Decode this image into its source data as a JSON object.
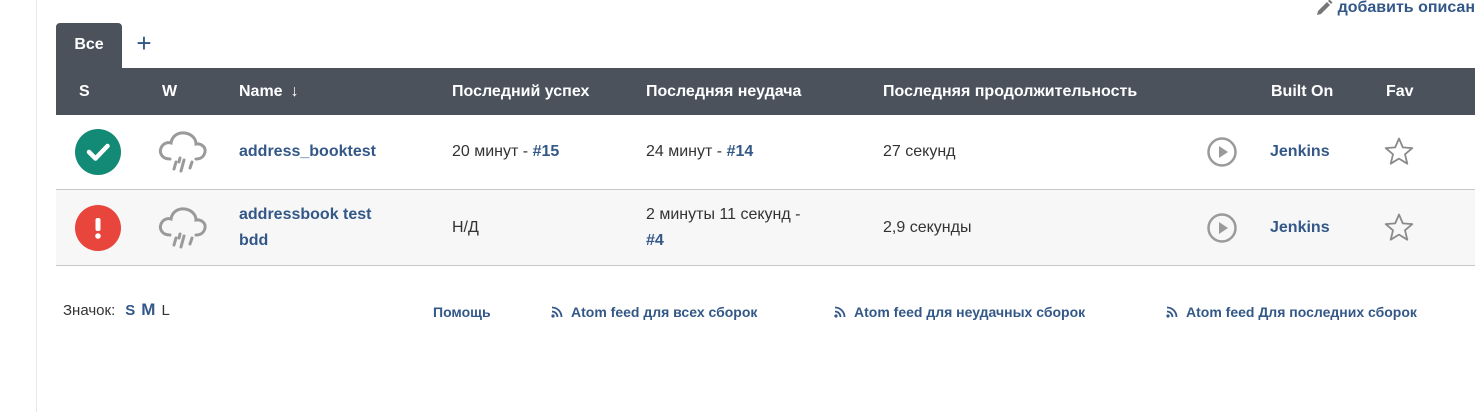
{
  "header": {
    "add_description": "добавить описан"
  },
  "tabs": {
    "active": "Все",
    "add": "+"
  },
  "table": {
    "columns": {
      "s": "S",
      "w": "W",
      "name": "Name",
      "name_sort": "↓",
      "last_success": "Последний успех",
      "last_failure": "Последняя неудача",
      "last_duration": "Последняя продолжительность",
      "built_on": "Built On",
      "fav": "Fav"
    },
    "rows": [
      {
        "status": "success",
        "weather": "rain-cloud-icon",
        "name": "address_booktest",
        "last_success_text": "20 минут - ",
        "last_success_build": "#15",
        "last_failure_text": "24 минут - ",
        "last_failure_build": "#14",
        "duration": "27 секунд",
        "built_on": "Jenkins"
      },
      {
        "status": "failure",
        "weather": "rain-cloud-icon",
        "name_line1": "addressbook test",
        "name_line2": "bdd",
        "last_success_text": "Н/Д",
        "last_failure_text": "2 минуты 11 секунд -",
        "last_failure_build": "#4",
        "duration": "2,9 секунды",
        "built_on": "Jenkins"
      }
    ]
  },
  "footer": {
    "icon_label": "Значок:",
    "size_s": "S",
    "size_m": "M",
    "size_l": "L",
    "help": "Помощь",
    "feed_all": "Atom feed для всех сборок",
    "feed_failed": "Atom feed для неудачных сборок",
    "feed_latest": "Atom feed Для последних сборок"
  },
  "colors": {
    "header_bg": "#4b525c",
    "link": "#335888",
    "success": "#138a75",
    "failure": "#e8453c",
    "icon_gray": "#9a9a9a"
  }
}
